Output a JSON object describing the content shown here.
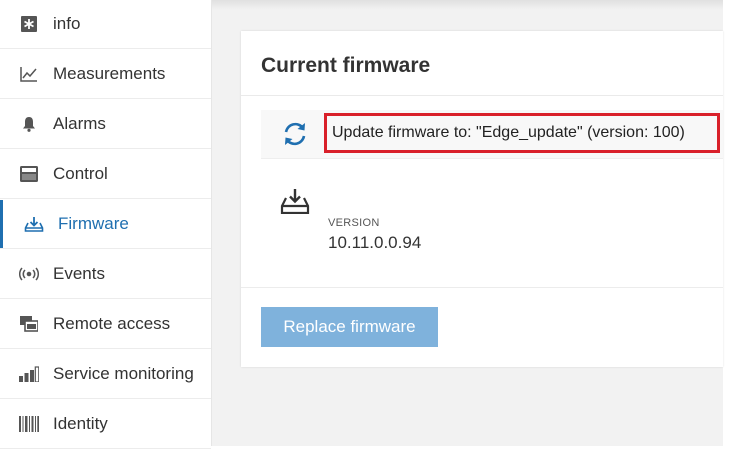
{
  "sidebar": {
    "items": [
      {
        "label": "info",
        "icon": "info-icon"
      },
      {
        "label": "Measurements",
        "icon": "chart-line-icon"
      },
      {
        "label": "Alarms",
        "icon": "bell-icon"
      },
      {
        "label": "Control",
        "icon": "control-icon"
      },
      {
        "label": "Firmware",
        "icon": "firmware-icon",
        "active": true
      },
      {
        "label": "Events",
        "icon": "events-icon"
      },
      {
        "label": "Remote access",
        "icon": "remote-access-icon"
      },
      {
        "label": "Service monitoring",
        "icon": "bars-icon"
      },
      {
        "label": "Identity",
        "icon": "barcode-icon"
      }
    ]
  },
  "card": {
    "title": "Current firmware",
    "update_text": "Update firmware to: \"Edge_update\" (version: 100)",
    "version_label": "VERSION",
    "version_value": "10.11.0.0.94",
    "replace_button": "Replace firmware"
  },
  "colors": {
    "accent": "#1f6fb0",
    "button": "#7fb2dc",
    "highlight_border": "#d9202a"
  }
}
